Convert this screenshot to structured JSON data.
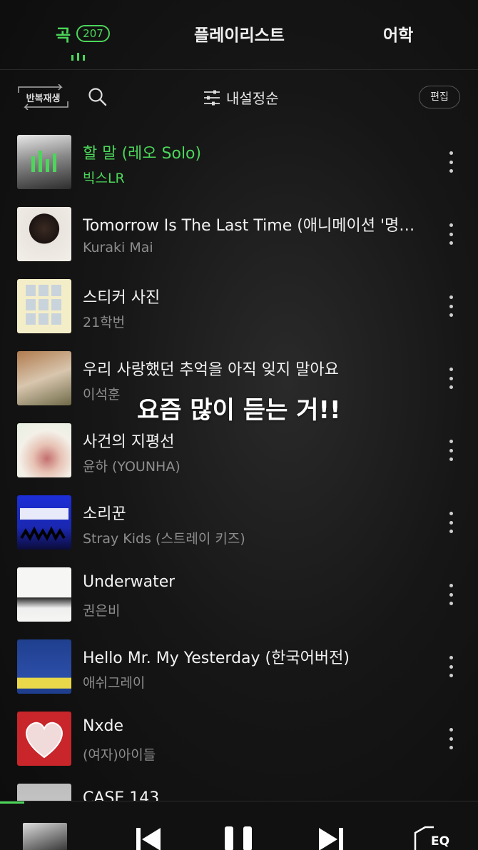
{
  "tabs": {
    "songs_label": "곡",
    "songs_count": "207",
    "playlist_label": "플레이리스트",
    "language_label": "어학"
  },
  "toolbar": {
    "repeat_label": "반복재생",
    "sort_label": "내설정순",
    "edit_label": "편집"
  },
  "songs": [
    {
      "title": "할 말 (레오 Solo)",
      "artist": "빅스LR",
      "playing": true
    },
    {
      "title": "Tomorrow Is The Last Time (애니메이션 '명…",
      "artist": "Kuraki Mai"
    },
    {
      "title": "스티커 사진",
      "artist": "21학번"
    },
    {
      "title": "우리 사랑했던 추억을 아직 잊지 말아요",
      "artist": "이석훈"
    },
    {
      "title": "사건의 지평선",
      "artist": "윤하 (YOUNHA)"
    },
    {
      "title": "소리꾼",
      "artist": "Stray Kids (스트레이 키즈)"
    },
    {
      "title": "Underwater",
      "artist": "권은비"
    },
    {
      "title": "Hello Mr.  My Yesterday (한국어버전)",
      "artist": "애쉬그레이"
    },
    {
      "title": "Nxde",
      "artist": "(여자)아이들"
    },
    {
      "title": "CASE 143",
      "artist": ""
    }
  ],
  "overlay_caption": "요즘 많이 듣는 거!!",
  "player": {
    "eq_label": "EQ",
    "progress_fraction": 0.05
  },
  "colors": {
    "accent": "#4cd65a",
    "background": "#141414"
  }
}
